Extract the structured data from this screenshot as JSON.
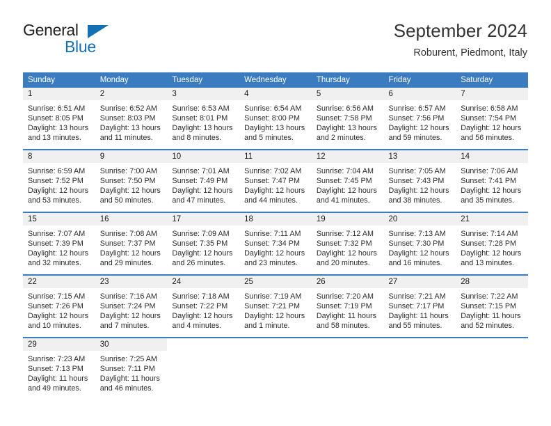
{
  "brand": {
    "name_part1": "General",
    "name_part2": "Blue",
    "triangle_color": "#1470b4",
    "text_color": "#231f20"
  },
  "header": {
    "title": "September 2024",
    "location": "Roburent, Piedmont, Italy",
    "header_bg": "#3a7cbf",
    "daynum_bg": "#f0f0f0"
  },
  "weekday_headers": [
    "Sunday",
    "Monday",
    "Tuesday",
    "Wednesday",
    "Thursday",
    "Friday",
    "Saturday"
  ],
  "weeks": [
    [
      {
        "day": "1",
        "sunrise": "Sunrise: 6:51 AM",
        "sunset": "Sunset: 8:05 PM",
        "daylight": "Daylight: 13 hours and 13 minutes."
      },
      {
        "day": "2",
        "sunrise": "Sunrise: 6:52 AM",
        "sunset": "Sunset: 8:03 PM",
        "daylight": "Daylight: 13 hours and 11 minutes."
      },
      {
        "day": "3",
        "sunrise": "Sunrise: 6:53 AM",
        "sunset": "Sunset: 8:01 PM",
        "daylight": "Daylight: 13 hours and 8 minutes."
      },
      {
        "day": "4",
        "sunrise": "Sunrise: 6:54 AM",
        "sunset": "Sunset: 8:00 PM",
        "daylight": "Daylight: 13 hours and 5 minutes."
      },
      {
        "day": "5",
        "sunrise": "Sunrise: 6:56 AM",
        "sunset": "Sunset: 7:58 PM",
        "daylight": "Daylight: 13 hours and 2 minutes."
      },
      {
        "day": "6",
        "sunrise": "Sunrise: 6:57 AM",
        "sunset": "Sunset: 7:56 PM",
        "daylight": "Daylight: 12 hours and 59 minutes."
      },
      {
        "day": "7",
        "sunrise": "Sunrise: 6:58 AM",
        "sunset": "Sunset: 7:54 PM",
        "daylight": "Daylight: 12 hours and 56 minutes."
      }
    ],
    [
      {
        "day": "8",
        "sunrise": "Sunrise: 6:59 AM",
        "sunset": "Sunset: 7:52 PM",
        "daylight": "Daylight: 12 hours and 53 minutes."
      },
      {
        "day": "9",
        "sunrise": "Sunrise: 7:00 AM",
        "sunset": "Sunset: 7:50 PM",
        "daylight": "Daylight: 12 hours and 50 minutes."
      },
      {
        "day": "10",
        "sunrise": "Sunrise: 7:01 AM",
        "sunset": "Sunset: 7:49 PM",
        "daylight": "Daylight: 12 hours and 47 minutes."
      },
      {
        "day": "11",
        "sunrise": "Sunrise: 7:02 AM",
        "sunset": "Sunset: 7:47 PM",
        "daylight": "Daylight: 12 hours and 44 minutes."
      },
      {
        "day": "12",
        "sunrise": "Sunrise: 7:04 AM",
        "sunset": "Sunset: 7:45 PM",
        "daylight": "Daylight: 12 hours and 41 minutes."
      },
      {
        "day": "13",
        "sunrise": "Sunrise: 7:05 AM",
        "sunset": "Sunset: 7:43 PM",
        "daylight": "Daylight: 12 hours and 38 minutes."
      },
      {
        "day": "14",
        "sunrise": "Sunrise: 7:06 AM",
        "sunset": "Sunset: 7:41 PM",
        "daylight": "Daylight: 12 hours and 35 minutes."
      }
    ],
    [
      {
        "day": "15",
        "sunrise": "Sunrise: 7:07 AM",
        "sunset": "Sunset: 7:39 PM",
        "daylight": "Daylight: 12 hours and 32 minutes."
      },
      {
        "day": "16",
        "sunrise": "Sunrise: 7:08 AM",
        "sunset": "Sunset: 7:37 PM",
        "daylight": "Daylight: 12 hours and 29 minutes."
      },
      {
        "day": "17",
        "sunrise": "Sunrise: 7:09 AM",
        "sunset": "Sunset: 7:35 PM",
        "daylight": "Daylight: 12 hours and 26 minutes."
      },
      {
        "day": "18",
        "sunrise": "Sunrise: 7:11 AM",
        "sunset": "Sunset: 7:34 PM",
        "daylight": "Daylight: 12 hours and 23 minutes."
      },
      {
        "day": "19",
        "sunrise": "Sunrise: 7:12 AM",
        "sunset": "Sunset: 7:32 PM",
        "daylight": "Daylight: 12 hours and 20 minutes."
      },
      {
        "day": "20",
        "sunrise": "Sunrise: 7:13 AM",
        "sunset": "Sunset: 7:30 PM",
        "daylight": "Daylight: 12 hours and 16 minutes."
      },
      {
        "day": "21",
        "sunrise": "Sunrise: 7:14 AM",
        "sunset": "Sunset: 7:28 PM",
        "daylight": "Daylight: 12 hours and 13 minutes."
      }
    ],
    [
      {
        "day": "22",
        "sunrise": "Sunrise: 7:15 AM",
        "sunset": "Sunset: 7:26 PM",
        "daylight": "Daylight: 12 hours and 10 minutes."
      },
      {
        "day": "23",
        "sunrise": "Sunrise: 7:16 AM",
        "sunset": "Sunset: 7:24 PM",
        "daylight": "Daylight: 12 hours and 7 minutes."
      },
      {
        "day": "24",
        "sunrise": "Sunrise: 7:18 AM",
        "sunset": "Sunset: 7:22 PM",
        "daylight": "Daylight: 12 hours and 4 minutes."
      },
      {
        "day": "25",
        "sunrise": "Sunrise: 7:19 AM",
        "sunset": "Sunset: 7:21 PM",
        "daylight": "Daylight: 12 hours and 1 minute."
      },
      {
        "day": "26",
        "sunrise": "Sunrise: 7:20 AM",
        "sunset": "Sunset: 7:19 PM",
        "daylight": "Daylight: 11 hours and 58 minutes."
      },
      {
        "day": "27",
        "sunrise": "Sunrise: 7:21 AM",
        "sunset": "Sunset: 7:17 PM",
        "daylight": "Daylight: 11 hours and 55 minutes."
      },
      {
        "day": "28",
        "sunrise": "Sunrise: 7:22 AM",
        "sunset": "Sunset: 7:15 PM",
        "daylight": "Daylight: 11 hours and 52 minutes."
      }
    ],
    [
      {
        "day": "29",
        "sunrise": "Sunrise: 7:23 AM",
        "sunset": "Sunset: 7:13 PM",
        "daylight": "Daylight: 11 hours and 49 minutes."
      },
      {
        "day": "30",
        "sunrise": "Sunrise: 7:25 AM",
        "sunset": "Sunset: 7:11 PM",
        "daylight": "Daylight: 11 hours and 46 minutes."
      },
      {
        "day": "",
        "sunrise": "",
        "sunset": "",
        "daylight": ""
      },
      {
        "day": "",
        "sunrise": "",
        "sunset": "",
        "daylight": ""
      },
      {
        "day": "",
        "sunrise": "",
        "sunset": "",
        "daylight": ""
      },
      {
        "day": "",
        "sunrise": "",
        "sunset": "",
        "daylight": ""
      },
      {
        "day": "",
        "sunrise": "",
        "sunset": "",
        "daylight": ""
      }
    ]
  ]
}
